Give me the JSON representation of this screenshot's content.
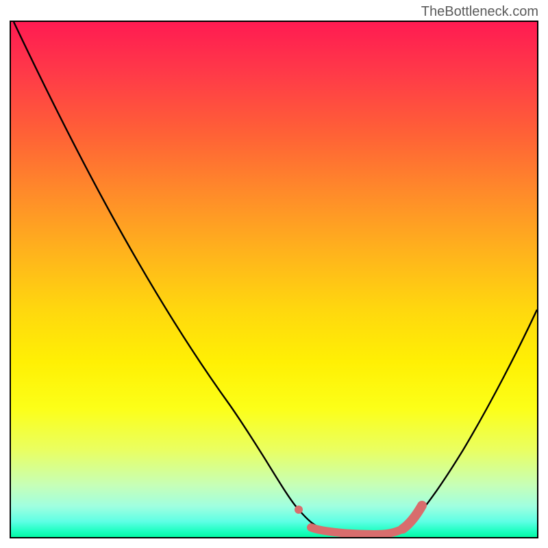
{
  "watermark": "TheBottleneck.com",
  "chart_data": {
    "type": "line",
    "title": "",
    "xlabel": "",
    "ylabel": "",
    "xlim": [
      0,
      100
    ],
    "ylim": [
      0,
      100
    ],
    "series": [
      {
        "name": "curve",
        "color": "#000000",
        "x": [
          0,
          5,
          10,
          15,
          20,
          25,
          30,
          35,
          40,
          45,
          50,
          53,
          56,
          60,
          65,
          70,
          74,
          78,
          82,
          86,
          90,
          94,
          98,
          100
        ],
        "y": [
          100,
          92,
          84,
          76,
          68,
          60,
          52,
          43,
          34,
          25,
          15,
          8,
          3,
          1,
          0.5,
          0.5,
          1,
          3,
          8,
          16,
          25,
          35,
          45,
          50
        ]
      },
      {
        "name": "highlight",
        "color": "#d86d6d",
        "x": [
          53,
          56,
          60,
          65,
          70,
          74
        ],
        "y": [
          8,
          3,
          1,
          0.5,
          0.5,
          1
        ]
      }
    ]
  }
}
